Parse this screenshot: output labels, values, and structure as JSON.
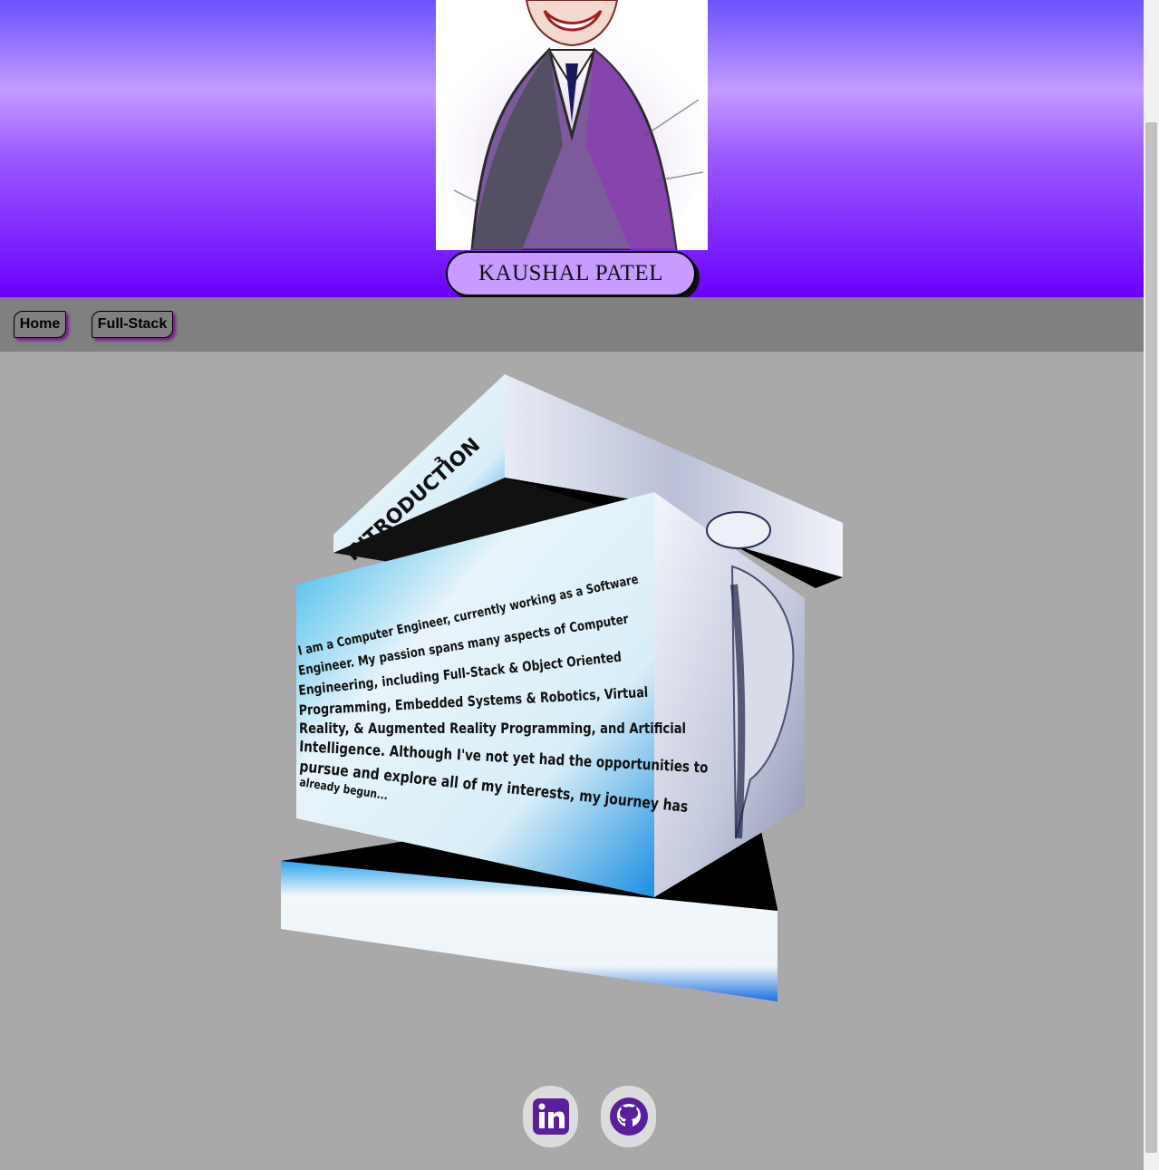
{
  "header": {
    "name": "KAUSHAL PATEL",
    "portrait_icon": "portrait-sketch-image"
  },
  "nav": {
    "items": [
      {
        "label": "Home"
      },
      {
        "label": "Full-Stack"
      }
    ]
  },
  "cube": {
    "top_label": "INTRODUCTION",
    "top_label_sup": "3",
    "intro_lines": [
      "I am a Computer Engineer, currently working as a Software",
      "Engineer. My passion spans many aspects of Computer",
      "Engineering, including Full-Stack & Object Oriented",
      "Programming, Embedded Systems & Robotics, Virtual",
      "Reality, & Augmented Reality Programming, and Artificial",
      "Intelligence. Although I've not yet had the opportunities to",
      "pursue and explore all of my interests, my journey has",
      "already begun..."
    ],
    "side_image_icon": "robot-face-image"
  },
  "social": {
    "linkedin_icon": "linkedin-icon",
    "github_icon": "github-icon"
  },
  "colors": {
    "accent_purple": "#6a00ff",
    "pill_fill": "#c79bff",
    "page_bg": "#a9a9a9",
    "nav_bg": "#808080",
    "icon_purple": "#5a1f9c"
  }
}
